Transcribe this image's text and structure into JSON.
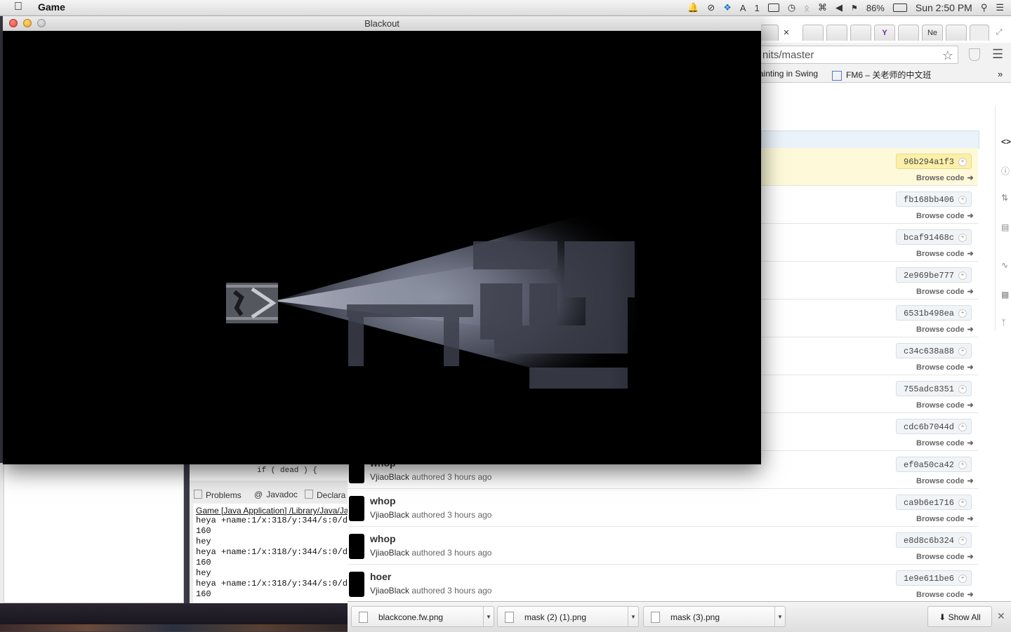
{
  "menubar": {
    "app_name": "Game",
    "status_badge": "1",
    "battery": "86%",
    "clock": "Sun 2:50 PM"
  },
  "game_window": {
    "title": "Blackout"
  },
  "browser": {
    "url_visible": "nits/master",
    "tab_labels": [
      "",
      "",
      "",
      "",
      "",
      "Ne",
      ""
    ],
    "bookmarks": [
      {
        "label": "ainting in Swing"
      },
      {
        "label": "FM6 – 关老师的中文班"
      }
    ],
    "commits": [
      {
        "sha": "96b294a1f3",
        "browse": "Browse code",
        "highlight": true
      },
      {
        "sha": "fb168bb406",
        "browse": "Browse code"
      },
      {
        "sha": "bcaf91468c",
        "browse": "Browse code"
      },
      {
        "sha": "2e969be777",
        "browse": "Browse code"
      },
      {
        "sha": "6531b498ea",
        "browse": "Browse code"
      },
      {
        "sha": "c34c638a88",
        "browse": "Browse code"
      },
      {
        "sha": "755adc8351",
        "browse": "Browse code"
      },
      {
        "sha": "cdc6b7044d",
        "browse": "Browse code"
      },
      {
        "sha": "ef0a50ca42",
        "browse": "Browse code",
        "title": "whop",
        "author": "VjiaoBlack",
        "meta": "authored 3 hours ago"
      },
      {
        "sha": "ca9b6e1716",
        "browse": "Browse code",
        "title": "whop",
        "author": "VjiaoBlack",
        "meta": "authored 3 hours ago"
      },
      {
        "sha": "e8d8c6b324",
        "browse": "Browse code",
        "title": "whop",
        "author": "VjiaoBlack",
        "meta": "authored 3 hours ago"
      },
      {
        "sha": "1e9e611be6",
        "browse": "Browse code",
        "title": "hoer",
        "author": "VjiaoBlack",
        "meta": "authored 3 hours ago"
      }
    ],
    "downloads": [
      {
        "name": "blackcone.fw.png"
      },
      {
        "name": "mask (2) (1).png"
      },
      {
        "name": "mask (3).png"
      }
    ],
    "show_all": "Show All"
  },
  "eclipse": {
    "code_fragment": "if ( dead     ) {",
    "view_tabs": [
      "Problems",
      "Javadoc",
      "Declara"
    ],
    "console_header": "Game [Java Application] /Library/Java/Ja",
    "console_lines": [
      "heya +name:1/x:318/y:344/s:0/d:",
      "160",
      "hey",
      "heya +name:1/x:318/y:344/s:0/d:",
      "160",
      "hey",
      "heya +name:1/x:318/y:344/s:0/d:",
      "160"
    ]
  },
  "colors": {
    "highlight_row": "#fdf9d9",
    "sha_bg": "#f1f4f7",
    "game_bg": "#000000"
  }
}
